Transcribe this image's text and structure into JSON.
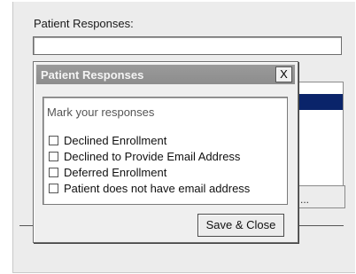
{
  "background": {
    "label": "Patient Responses:",
    "input_value": "",
    "button_label": "..."
  },
  "dialog": {
    "title": "Patient Responses",
    "close_label": "X",
    "group_label": "Mark your responses",
    "options": [
      {
        "label": "Declined Enrollment",
        "checked": false
      },
      {
        "label": "Declined to Provide Email Address",
        "checked": false
      },
      {
        "label": "Deferred Enrollment",
        "checked": false
      },
      {
        "label": "Patient does not have email address",
        "checked": false
      }
    ],
    "save_label": "Save & Close"
  },
  "colors": {
    "titlebar": "#8d8d8d",
    "selection": "#0a246a"
  }
}
